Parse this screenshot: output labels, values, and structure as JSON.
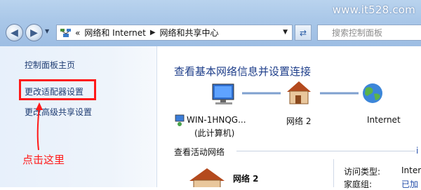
{
  "watermark": "www.it528.com",
  "address_bar": {
    "prefix": "«",
    "crumb1": "网络和 Internet",
    "crumb2": "网络和共享中心"
  },
  "search": {
    "placeholder": "搜索控制面板"
  },
  "sidebar": {
    "items": [
      {
        "label": "控制面板主页"
      },
      {
        "label": "更改适配器设置"
      },
      {
        "label": "更改高级共享设置"
      }
    ]
  },
  "annotation": {
    "text": "点击这里",
    "color": "#ff1a1a"
  },
  "main": {
    "title": "查看基本网络信息并设置连接",
    "map": {
      "computer_name": "WIN-1HNQG...",
      "computer_sub": "(此计算机)",
      "network": "网络  2",
      "internet": "Internet"
    },
    "active_section": "查看活动网络",
    "active_edge": "i",
    "active_network": {
      "name": "网络  2",
      "access_type_label": "访问类型:",
      "access_type_value": "Inter",
      "homegroup_label": "家庭组:",
      "homegroup_value": "已加"
    }
  },
  "icons": {
    "back": "back-arrow-icon",
    "forward": "forward-arrow-icon",
    "refresh": "refresh-icon",
    "search": "search-icon",
    "computer": "computer-icon",
    "house": "house-network-icon",
    "globe": "globe-internet-icon"
  },
  "colors": {
    "link": "#1f3d73",
    "title": "#1e3e8a",
    "highlight": "#ff1a1a"
  }
}
